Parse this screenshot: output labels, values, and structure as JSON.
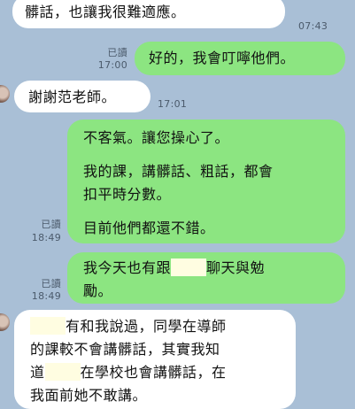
{
  "messages": {
    "m1": {
      "line1": "髒話，也讓我很難適應。",
      "time": "07:43"
    },
    "m2": {
      "text": "好的，我會叮嚀他們。",
      "read_label": "已讀",
      "time": "17:00"
    },
    "m3": {
      "text": "謝謝范老師。",
      "time": "17:01"
    },
    "m4": {
      "p1": "不客氣。讓您操心了。",
      "p2_l1": "我的課，講髒話、粗話，都會",
      "p2_l2": "扣平時分數。",
      "p3": "目前他們都還不錯。",
      "read_label": "已讀",
      "time": "18:49"
    },
    "m5": {
      "l1_a": "我今天也有跟",
      "l1_b": "聊天與勉",
      "l2": "勵。",
      "read_label": "已讀",
      "time": "18:49"
    },
    "m6": {
      "l1": "有和我說過，同學在導師",
      "l2": "的課較不會講髒話，其實我知",
      "l3_a": "道",
      "l3_b": "在學校也會講髒話，在",
      "l4": "我面前她不敢講。"
    }
  },
  "colors": {
    "background": "#a9bfd6",
    "incoming_bubble": "#ffffff",
    "outgoing_bubble": "#8ce581",
    "redaction": "#fffde1"
  }
}
